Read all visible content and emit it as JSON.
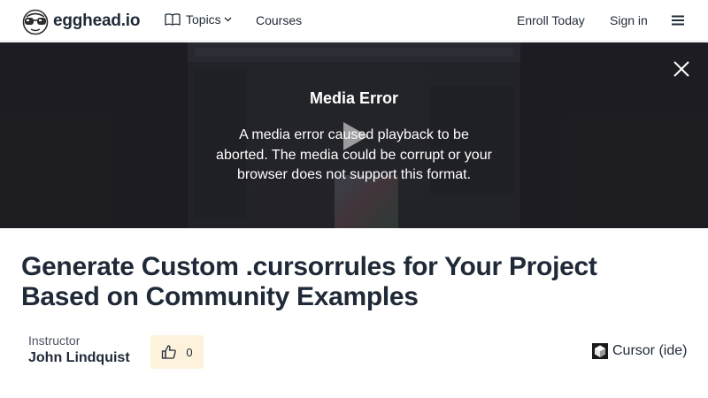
{
  "header": {
    "brand": "egghead.io",
    "topics_label": "Topics",
    "courses_label": "Courses",
    "enroll_label": "Enroll Today",
    "signin_label": "Sign in"
  },
  "player": {
    "error_title": "Media Error",
    "error_message": "A media error caused playback to be aborted. The media could be corrupt or your browser does not support this format."
  },
  "lesson": {
    "title": "Generate Custom .cursorrules for Your Project Based on Community Examples",
    "instructor_label": "Instructor",
    "instructor_name": "John Lindquist",
    "like_count": "0",
    "tag_label": "Cursor (ide)"
  }
}
